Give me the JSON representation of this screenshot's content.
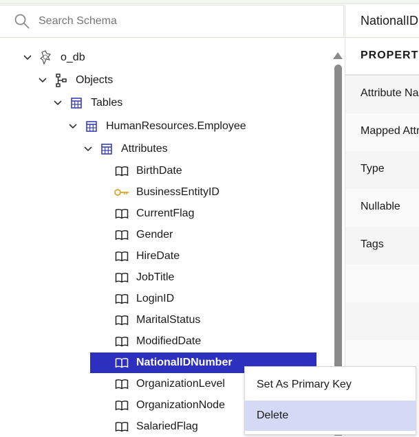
{
  "search": {
    "placeholder": "Search Schema",
    "value": ""
  },
  "tree": {
    "database": {
      "label": "o_db",
      "expanded": true
    },
    "objects": {
      "label": "Objects",
      "expanded": true
    },
    "tables": {
      "label": "Tables",
      "expanded": true
    },
    "table": {
      "label": "HumanResources.Employee",
      "expanded": true
    },
    "attributes": {
      "label": "Attributes",
      "expanded": true
    },
    "attribute_items": [
      {
        "label": "BirthDate",
        "icon": "book-icon"
      },
      {
        "label": "BusinessEntityID",
        "icon": "key-icon"
      },
      {
        "label": "CurrentFlag",
        "icon": "book-icon"
      },
      {
        "label": "Gender",
        "icon": "book-icon"
      },
      {
        "label": "HireDate",
        "icon": "book-icon"
      },
      {
        "label": "JobTitle",
        "icon": "book-icon"
      },
      {
        "label": "LoginID",
        "icon": "book-icon"
      },
      {
        "label": "MaritalStatus",
        "icon": "book-icon"
      },
      {
        "label": "ModifiedDate",
        "icon": "book-icon"
      },
      {
        "label": "NationalIDNumber",
        "icon": "book-icon",
        "selected": true
      },
      {
        "label": "OrganizationLevel",
        "icon": "book-icon"
      },
      {
        "label": "OrganizationNode",
        "icon": "book-icon"
      },
      {
        "label": "SalariedFlag",
        "icon": "book-icon"
      }
    ]
  },
  "details": {
    "title": "NationalIDNumber",
    "header": "PROPERTY",
    "rows": [
      "Attribute Name",
      "Mapped Attribute",
      "Type",
      "Nullable",
      "Tags",
      "",
      ""
    ]
  },
  "context_menu": {
    "items": [
      {
        "label": "Set As Primary Key",
        "hovered": false
      },
      {
        "label": "Delete",
        "hovered": true
      }
    ]
  },
  "colors": {
    "selection": "#2d2fbf",
    "table_icon": "#3b3fb5",
    "key_icon": "#e0a526",
    "menu_hover": "#d4d9f6"
  }
}
